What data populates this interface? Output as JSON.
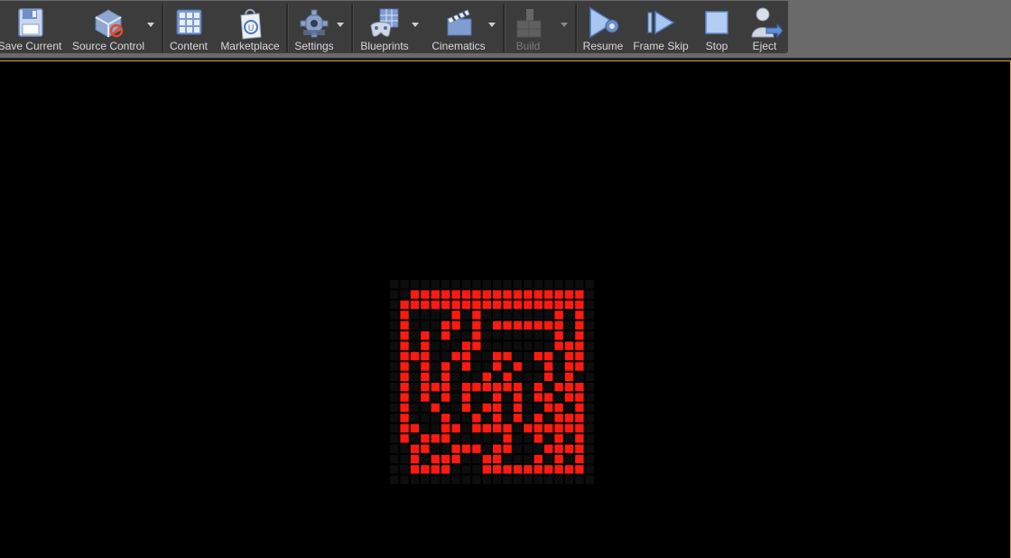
{
  "toolbar": {
    "items": [
      {
        "label": "Save Current",
        "icon": "floppy-disk-icon",
        "enabled": true
      },
      {
        "label": "Source Control",
        "icon": "source-control-disabled-icon",
        "enabled": true,
        "has_dropdown": true
      },
      {
        "label": "Content",
        "icon": "content-grid-icon",
        "enabled": true
      },
      {
        "label": "Marketplace",
        "icon": "marketplace-bag-icon",
        "enabled": true
      },
      {
        "label": "Settings",
        "icon": "gear-icon",
        "enabled": true,
        "has_dropdown": true
      },
      {
        "label": "Blueprints",
        "icon": "blueprint-gamepad-icon",
        "enabled": true,
        "has_dropdown": true
      },
      {
        "label": "Cinematics",
        "icon": "clapperboard-icon",
        "enabled": true,
        "has_dropdown": true
      },
      {
        "label": "Build",
        "icon": "build-blocks-icon",
        "enabled": false,
        "has_dropdown": true
      },
      {
        "label": "Resume",
        "icon": "play-resume-icon",
        "enabled": true
      },
      {
        "label": "Frame Skip",
        "icon": "frame-skip-icon",
        "enabled": true
      },
      {
        "label": "Stop",
        "icon": "stop-icon",
        "enabled": true
      },
      {
        "label": "Eject",
        "icon": "eject-person-icon",
        "enabled": true
      }
    ]
  },
  "viewport": {
    "colors": {
      "background": "#000000",
      "maze_cell_on": "#ff1a10",
      "maze_cell_off": "#0d0d0d",
      "border": "#c89a3c"
    },
    "maze_grid": [
      "00000000000000000000",
      "00111111111111111110",
      "01111111111111111110",
      "01000010100000001010",
      "01000110101111111010",
      "01010100100000001010",
      "01010001100000001110",
      "01110011001100110110",
      "01010101001010010110",
      "01010100010100010100",
      "01011101111110101110",
      "01010101001010110110",
      "01001001011010011010",
      "01000100101010101110",
      "01100110111101111110",
      "01011100000100101010",
      "00110011101100011110",
      "00101110011000101010",
      "00111100011111111110",
      "00000000000000000000"
    ]
  }
}
